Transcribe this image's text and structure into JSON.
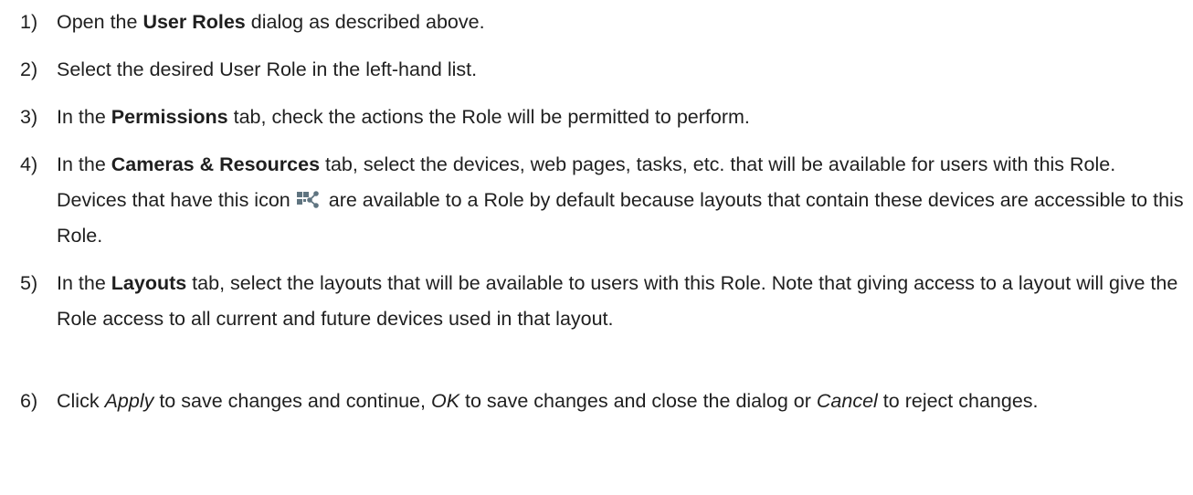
{
  "steps": [
    {
      "number": "1)",
      "parts": [
        "Open the ",
        "User Roles",
        " dialog as described above."
      ]
    },
    {
      "number": "2)",
      "parts": [
        "Select the desired User Role in the left-hand list."
      ]
    },
    {
      "number": "3)",
      "parts": [
        "In the ",
        "Permissions",
        " tab, check the actions the Role will be permitted to perform."
      ]
    },
    {
      "number": "4)",
      "parts": [
        "In the ",
        "Cameras & Resources",
        " tab, select the devices, web pages, tasks, etc. that will be available for users with this Role. Devices that have this icon",
        "are available to a Role by default because layouts that contain these devices are accessible to this Role."
      ],
      "icon": "shared-layout-device-icon"
    },
    {
      "number": "5)",
      "parts": [
        "In the ",
        "Layouts",
        " tab, select the layouts that will be available to users with this Role. Note that giving access to a layout will give the Role access to all current and future devices used in that layout."
      ]
    },
    {
      "number": "6)",
      "parts": [
        "Click ",
        "Apply",
        " to save changes and continue, ",
        "OK",
        " to save changes and close the dialog or ",
        "Cancel",
        " to reject changes."
      ]
    }
  ]
}
